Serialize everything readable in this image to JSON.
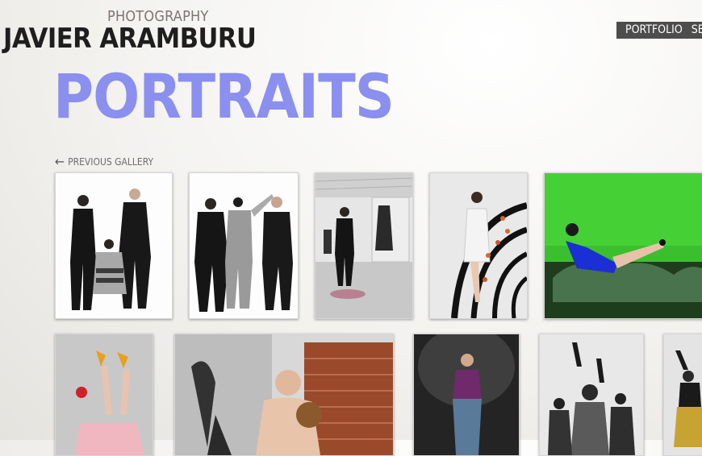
{
  "header": {
    "logo_sub": "PHOTOGRAPHY",
    "logo_name": "JAVIER ARAMBURU",
    "nav": [
      "PORTFOLIO",
      "SERVICES"
    ]
  },
  "gallery": {
    "title": "PORTRAITS",
    "prev_label": "PREVIOUS GALLERY",
    "accent": "#8a8ff0",
    "thumbnails": [
      "two men in suits with crouching woman",
      "three people in black and silver outfits",
      "woman in white gallery space",
      "woman in white dress lying on curved steps",
      "woman in blue dress on green background",
      "legs in orange heels",
      "shirtless man with boxing glove and flowers",
      "man in purple jacket against grey wall",
      "group of dancers",
      "dancer in gold pants"
    ]
  }
}
